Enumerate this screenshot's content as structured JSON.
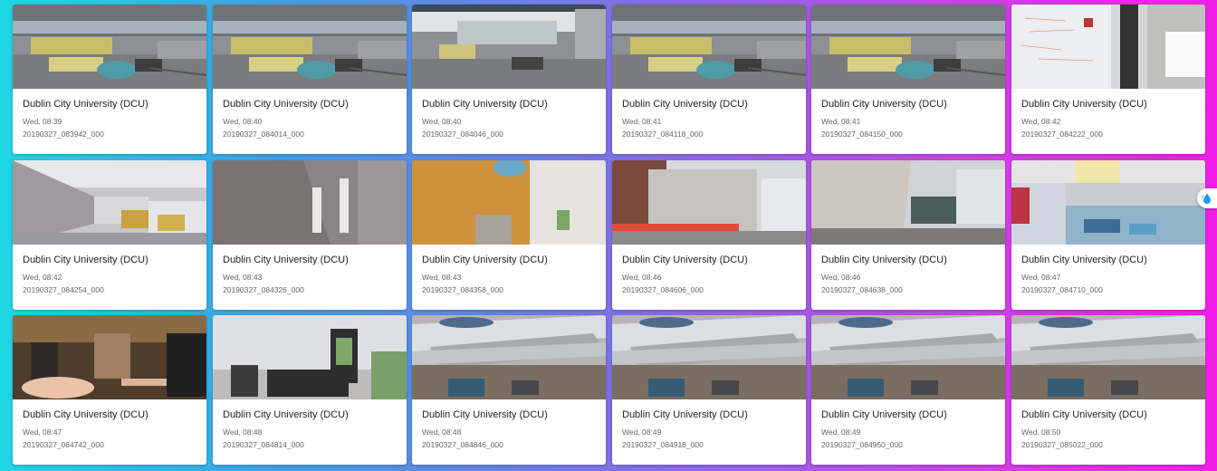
{
  "images": [
    {
      "location": "Dublin City University (DCU)",
      "time": "Wed, 08:39",
      "filename": "20190327_083942_000",
      "scene": "desk"
    },
    {
      "location": "Dublin City University (DCU)",
      "time": "Wed, 08:40",
      "filename": "20190327_084014_000",
      "scene": "desk"
    },
    {
      "location": "Dublin City University (DCU)",
      "time": "Wed, 08:40",
      "filename": "20190327_084046_000",
      "scene": "desk-monitor"
    },
    {
      "location": "Dublin City University (DCU)",
      "time": "Wed, 08:41",
      "filename": "20190327_084118_000",
      "scene": "desk"
    },
    {
      "location": "Dublin City University (DCU)",
      "time": "Wed, 08:41",
      "filename": "20190327_084150_000",
      "scene": "desk"
    },
    {
      "location": "Dublin City University (DCU)",
      "time": "Wed, 08:42",
      "filename": "20190327_084222_000",
      "scene": "whiteboard"
    },
    {
      "location": "Dublin City University (DCU)",
      "time": "Wed, 08:42",
      "filename": "20190327_084254_000",
      "scene": "office"
    },
    {
      "location": "Dublin City University (DCU)",
      "time": "Wed, 08:43",
      "filename": "20190327_084326_000",
      "scene": "door-grey"
    },
    {
      "location": "Dublin City University (DCU)",
      "time": "Wed, 08:43",
      "filename": "20190327_084358_000",
      "scene": "door-wood"
    },
    {
      "location": "Dublin City University (DCU)",
      "time": "Wed, 08:46",
      "filename": "20190327_084606_000",
      "scene": "building"
    },
    {
      "location": "Dublin City University (DCU)",
      "time": "Wed, 08:46",
      "filename": "20190327_084638_000",
      "scene": "building-wall"
    },
    {
      "location": "Dublin City University (DCU)",
      "time": "Wed, 08:47",
      "filename": "20190327_084710_000",
      "scene": "cafe"
    },
    {
      "location": "Dublin City University (DCU)",
      "time": "Wed, 08:47",
      "filename": "20190327_084742_000",
      "scene": "coffee-shop"
    },
    {
      "location": "Dublin City University (DCU)",
      "time": "Wed, 08:48",
      "filename": "20190327_084814_000",
      "scene": "counter"
    },
    {
      "location": "Dublin City University (DCU)",
      "time": "Wed, 08:48",
      "filename": "20190327_084846_000",
      "scene": "atrium"
    },
    {
      "location": "Dublin City University (DCU)",
      "time": "Wed, 08:49",
      "filename": "20190327_084918_000",
      "scene": "atrium"
    },
    {
      "location": "Dublin City University (DCU)",
      "time": "Wed, 08:49",
      "filename": "20190327_084950_000",
      "scene": "atrium"
    },
    {
      "location": "Dublin City University (DCU)",
      "time": "Wed, 08:50",
      "filename": "20190327_085022_000",
      "scene": "atrium"
    }
  ],
  "side_button": {
    "icon": "water-drop-icon"
  },
  "colors": {
    "background_start": "#1fd6e3",
    "background_end": "#f21ee8",
    "card": "#ffffff",
    "accent": "#2196f3"
  }
}
